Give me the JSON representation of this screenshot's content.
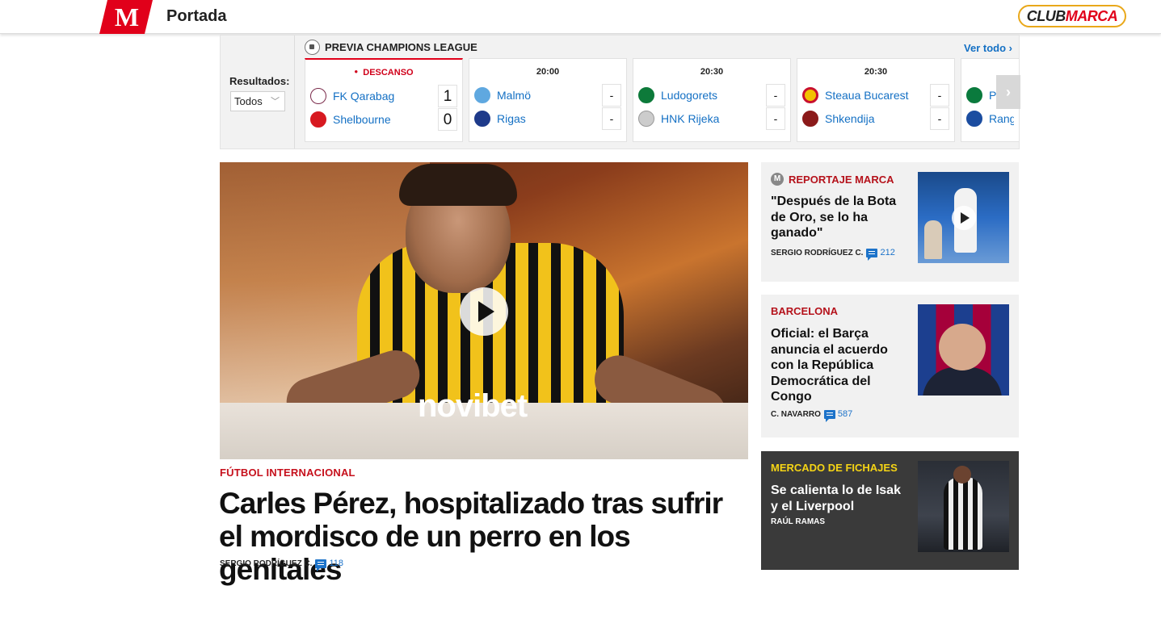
{
  "header": {
    "logo_letter": "M",
    "section_title": "Portada",
    "club_a": "CLUB",
    "club_b": "MARCA"
  },
  "scores": {
    "filter_label": "Resultados:",
    "filter_value": "Todos",
    "competition": "PREVIA CHAMPIONS LEAGUE",
    "see_all": "Ver todo ›",
    "matches": [
      {
        "status": "DESCANSO",
        "home": "FK Qarabag",
        "away": "Shelbourne",
        "home_score": "1",
        "away_score": "0",
        "home_color": "#ffffff",
        "away_color": "#d71920"
      },
      {
        "status": "20:00",
        "home": "Malmö",
        "away": "Rigas",
        "home_score": "-",
        "away_score": "-",
        "home_color": "#5fa8e0",
        "away_color": "#1e3a8a"
      },
      {
        "status": "20:30",
        "home": "Ludogorets",
        "away": "HNK Rijeka",
        "home_score": "-",
        "away_score": "-",
        "home_color": "#0d7a3a",
        "away_color": "#cccccc"
      },
      {
        "status": "20:30",
        "home": "Steaua Bucarest",
        "away": "Shkendija",
        "home_score": "-",
        "away_score": "-",
        "home_color": "#c8102e",
        "away_color": "#8b1a1a"
      },
      {
        "status": "",
        "home": "Pa",
        "away": "Range",
        "home_score": "",
        "away_score": "",
        "home_color": "#0a7a3d",
        "away_color": "#1b4da0"
      }
    ]
  },
  "main_story": {
    "sponsor": "novibet",
    "kicker": "FÚTBOL INTERNACIONAL",
    "headline": "Carles Pérez, hospitalizado tras sufrir el mordisco de un perro en los genitales",
    "author": "SERGIO RODRÍGUEZ C.",
    "comments": "118"
  },
  "side_stories": [
    {
      "kicker": "REPORTAJE MARCA",
      "badge": "M",
      "title": "\"Después de la Bota de Oro, se lo ha ganado\"",
      "author": "SERGIO RODRÍGUEZ C.",
      "comments": "212"
    },
    {
      "kicker": "BARCELONA",
      "title": "Oficial: el Barça anuncia el acuerdo con la República Democrática del Congo",
      "author": "C. NAVARRO",
      "comments": "587"
    },
    {
      "kicker": "MERCADO DE FICHAJES",
      "title": "Se calienta lo de Isak y el Liverpool",
      "author": "RAÚL RAMAS"
    }
  ],
  "colors": {
    "brand_red": "#e1001a",
    "link_blue": "#1470c4",
    "gold": "#f5d415"
  }
}
